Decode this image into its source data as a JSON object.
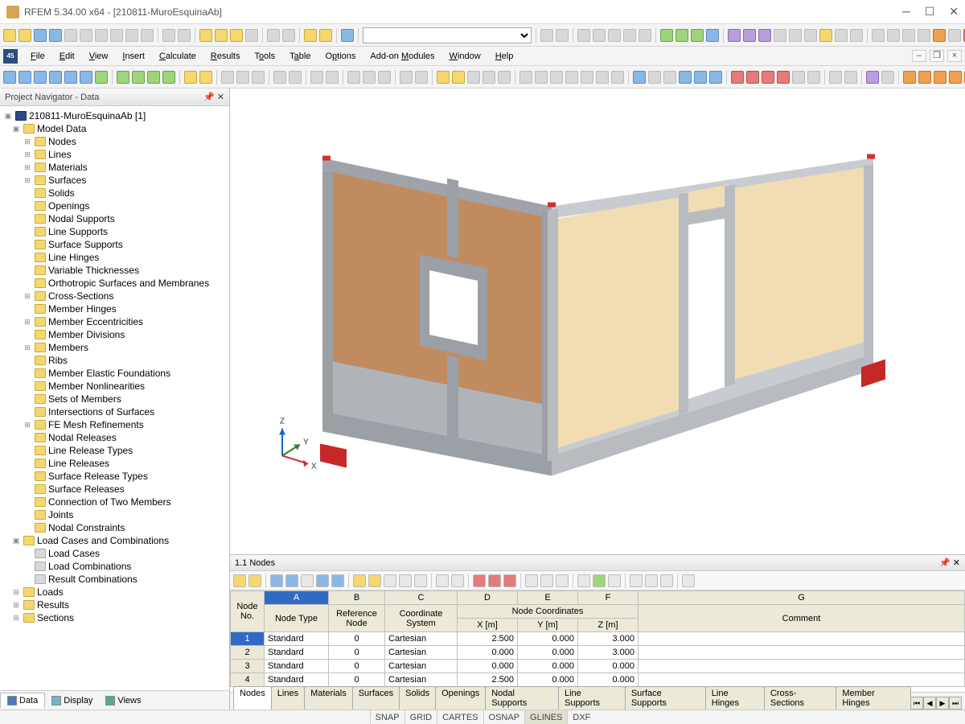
{
  "app": {
    "title": "RFEM 5.34.00 x64 - [210811-MuroEsquinaAb]"
  },
  "menu": {
    "items": [
      "File",
      "Edit",
      "View",
      "Insert",
      "Calculate",
      "Results",
      "Tools",
      "Table",
      "Options",
      "Add-on Modules",
      "Window",
      "Help"
    ],
    "logo": "45"
  },
  "navigator": {
    "title": "Project Navigator - Data",
    "project": "210811-MuroEsquinaAb [1]",
    "model_data": "Model Data",
    "items": [
      "Nodes",
      "Lines",
      "Materials",
      "Surfaces",
      "Solids",
      "Openings",
      "Nodal Supports",
      "Line Supports",
      "Surface Supports",
      "Line Hinges",
      "Variable Thicknesses",
      "Orthotropic Surfaces and Membranes",
      "Cross-Sections",
      "Member Hinges",
      "Member Eccentricities",
      "Member Divisions",
      "Members",
      "Ribs",
      "Member Elastic Foundations",
      "Member Nonlinearities",
      "Sets of Members",
      "Intersections of Surfaces",
      "FE Mesh Refinements",
      "Nodal Releases",
      "Line Release Types",
      "Line Releases",
      "Surface Release Types",
      "Surface Releases",
      "Connection of Two Members",
      "Joints",
      "Nodal Constraints"
    ],
    "load_section": "Load Cases and Combinations",
    "load_items": [
      "Load Cases",
      "Load Combinations",
      "Result Combinations"
    ],
    "extra_folders": [
      "Loads",
      "Results",
      "Sections"
    ],
    "tabs": [
      "Data",
      "Display",
      "Views"
    ]
  },
  "axes": {
    "x": "X",
    "y": "Y",
    "z": "Z"
  },
  "table": {
    "title": "1.1 Nodes",
    "col_letters": [
      "A",
      "B",
      "C",
      "D",
      "E",
      "F",
      "G"
    ],
    "group_header_rownum": "Node No.",
    "group_headers": [
      "Node Type",
      "Reference Node",
      "Coordinate System",
      "Node Coordinates",
      "Comment"
    ],
    "sub_headers": [
      "X [m]",
      "Y [m]",
      "Z [m]"
    ],
    "rows": [
      {
        "no": "1",
        "type": "Standard",
        "ref": "0",
        "sys": "Cartesian",
        "x": "2.500",
        "y": "0.000",
        "z": "3.000",
        "c": ""
      },
      {
        "no": "2",
        "type": "Standard",
        "ref": "0",
        "sys": "Cartesian",
        "x": "0.000",
        "y": "0.000",
        "z": "3.000",
        "c": ""
      },
      {
        "no": "3",
        "type": "Standard",
        "ref": "0",
        "sys": "Cartesian",
        "x": "0.000",
        "y": "0.000",
        "z": "0.000",
        "c": ""
      },
      {
        "no": "4",
        "type": "Standard",
        "ref": "0",
        "sys": "Cartesian",
        "x": "2.500",
        "y": "0.000",
        "z": "0.000",
        "c": ""
      }
    ],
    "bottom_tabs": [
      "Nodes",
      "Lines",
      "Materials",
      "Surfaces",
      "Solids",
      "Openings",
      "Nodal Supports",
      "Line Supports",
      "Surface Supports",
      "Line Hinges",
      "Cross-Sections",
      "Member Hinges"
    ]
  },
  "status": {
    "buttons": [
      "SNAP",
      "GRID",
      "CARTES",
      "OSNAP",
      "GLINES",
      "DXF"
    ]
  }
}
